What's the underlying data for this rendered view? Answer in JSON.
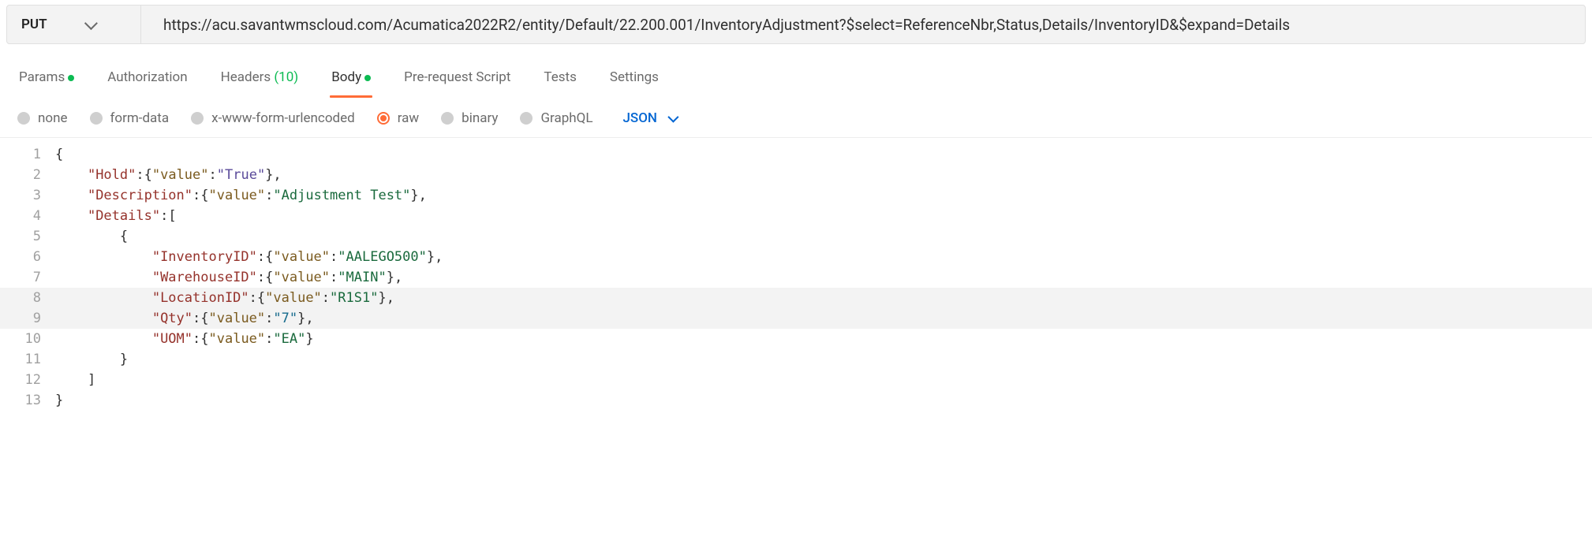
{
  "request": {
    "method": "PUT",
    "url": "https://acu.savantwmscloud.com/Acumatica2022R2/entity/Default/22.200.001/InventoryAdjustment?$select=ReferenceNbr,Status,Details/InventoryID&$expand=Details"
  },
  "tabs": {
    "params": {
      "label": "Params",
      "has_dot": true
    },
    "authorization": {
      "label": "Authorization"
    },
    "headers": {
      "label": "Headers",
      "count": "(10)"
    },
    "body": {
      "label": "Body",
      "has_dot": true,
      "active": true
    },
    "prerequest": {
      "label": "Pre-request Script"
    },
    "tests": {
      "label": "Tests"
    },
    "settings": {
      "label": "Settings"
    }
  },
  "body_types": {
    "none": "none",
    "formdata": "form-data",
    "urlencoded": "x-www-form-urlencoded",
    "raw": "raw",
    "binary": "binary",
    "graphql": "GraphQL",
    "language": "JSON"
  },
  "code": {
    "line_count": 13,
    "tokens": [
      [
        {
          "t": "punc",
          "v": "{"
        }
      ],
      [
        {
          "t": "indent",
          "v": "    "
        },
        {
          "t": "key",
          "v": "\"Hold\""
        },
        {
          "t": "punc",
          "v": ":{"
        },
        {
          "t": "prop",
          "v": "\"value\""
        },
        {
          "t": "punc",
          "v": ":"
        },
        {
          "t": "value",
          "v": "\"True\""
        },
        {
          "t": "punc",
          "v": "},"
        }
      ],
      [
        {
          "t": "indent",
          "v": "    "
        },
        {
          "t": "key",
          "v": "\"Description\""
        },
        {
          "t": "punc",
          "v": ":{"
        },
        {
          "t": "prop",
          "v": "\"value\""
        },
        {
          "t": "punc",
          "v": ":"
        },
        {
          "t": "string",
          "v": "\"Adjustment Test\""
        },
        {
          "t": "punc",
          "v": "},"
        }
      ],
      [
        {
          "t": "indent",
          "v": "    "
        },
        {
          "t": "key",
          "v": "\"Details\""
        },
        {
          "t": "punc",
          "v": ":["
        }
      ],
      [
        {
          "t": "indent",
          "v": "        "
        },
        {
          "t": "punc",
          "v": "{"
        }
      ],
      [
        {
          "t": "indent",
          "v": "            "
        },
        {
          "t": "key",
          "v": "\"InventoryID\""
        },
        {
          "t": "punc",
          "v": ":{"
        },
        {
          "t": "prop",
          "v": "\"value\""
        },
        {
          "t": "punc",
          "v": ":"
        },
        {
          "t": "string",
          "v": "\"AALEGO500\""
        },
        {
          "t": "punc",
          "v": "},"
        }
      ],
      [
        {
          "t": "indent",
          "v": "            "
        },
        {
          "t": "key",
          "v": "\"WarehouseID\""
        },
        {
          "t": "punc",
          "v": ":{"
        },
        {
          "t": "prop",
          "v": "\"value\""
        },
        {
          "t": "punc",
          "v": ":"
        },
        {
          "t": "string",
          "v": "\"MAIN\""
        },
        {
          "t": "punc",
          "v": "},"
        }
      ],
      [
        {
          "t": "indent",
          "v": "            "
        },
        {
          "t": "key",
          "v": "\"LocationID\""
        },
        {
          "t": "punc",
          "v": ":{"
        },
        {
          "t": "prop",
          "v": "\"value\""
        },
        {
          "t": "punc",
          "v": ":"
        },
        {
          "t": "string",
          "v": "\"R1S1\""
        },
        {
          "t": "punc",
          "v": "},"
        }
      ],
      [
        {
          "t": "indent",
          "v": "            "
        },
        {
          "t": "key",
          "v": "\"Qty\""
        },
        {
          "t": "punc",
          "v": ":{"
        },
        {
          "t": "prop",
          "v": "\"value\""
        },
        {
          "t": "punc",
          "v": ":"
        },
        {
          "t": "num",
          "v": "\"7\""
        },
        {
          "t": "punc",
          "v": "},"
        }
      ],
      [
        {
          "t": "indent",
          "v": "            "
        },
        {
          "t": "key",
          "v": "\"UOM\""
        },
        {
          "t": "punc",
          "v": ":{"
        },
        {
          "t": "prop",
          "v": "\"value\""
        },
        {
          "t": "punc",
          "v": ":"
        },
        {
          "t": "string",
          "v": "\"EA\""
        },
        {
          "t": "punc",
          "v": "}"
        }
      ],
      [
        {
          "t": "indent",
          "v": "        "
        },
        {
          "t": "punc",
          "v": "}"
        }
      ],
      [
        {
          "t": "indent",
          "v": "    "
        },
        {
          "t": "punc",
          "v": "]"
        }
      ],
      [
        {
          "t": "punc",
          "v": "}"
        }
      ]
    ],
    "highlighted_lines": [
      8,
      9
    ]
  }
}
